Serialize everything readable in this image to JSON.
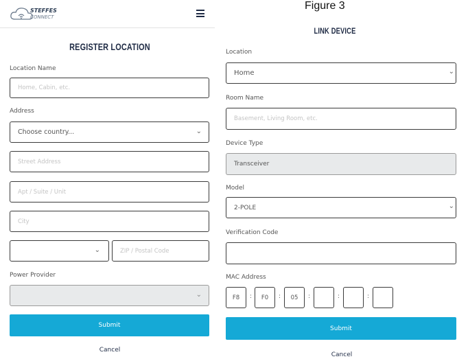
{
  "figure_label": "Figure 3",
  "header": {
    "logo_line1": "STEFFES",
    "logo_line2": "CONNECT",
    "menu_icon": "hamburger-icon"
  },
  "register": {
    "title": "REGISTER LOCATION",
    "location_name_label": "Location Name",
    "location_name_placeholder": "Home, Cabin, etc.",
    "address_label": "Address",
    "country_value": "Choose country...",
    "street_placeholder": "Street Address",
    "apt_placeholder": "Apt / Suite / Unit",
    "city_placeholder": "City",
    "state_value": "",
    "zip_placeholder": "ZIP / Postal Code",
    "power_provider_label": "Power Provider",
    "power_provider_value": "",
    "submit_label": "Submit",
    "cancel_label": "Cancel"
  },
  "link": {
    "title": "LINK DEVICE",
    "location_label": "Location",
    "location_value": "Home",
    "room_label": "Room Name",
    "room_placeholder": "Basement, Living Room, etc.",
    "device_type_label": "Device Type",
    "device_type_value": "Transceiver",
    "model_label": "Model",
    "model_value": "2-POLE",
    "verification_label": "Verification Code",
    "verification_value": "",
    "mac_label": "MAC Address",
    "mac_values": [
      "F8",
      "F0",
      "05",
      "",
      "",
      ""
    ],
    "submit_label": "Submit",
    "cancel_label": "Cancel"
  },
  "colors": {
    "accent": "#15a9d6",
    "title": "#1e2a44",
    "disabled_bg": "#e8eaeb"
  }
}
